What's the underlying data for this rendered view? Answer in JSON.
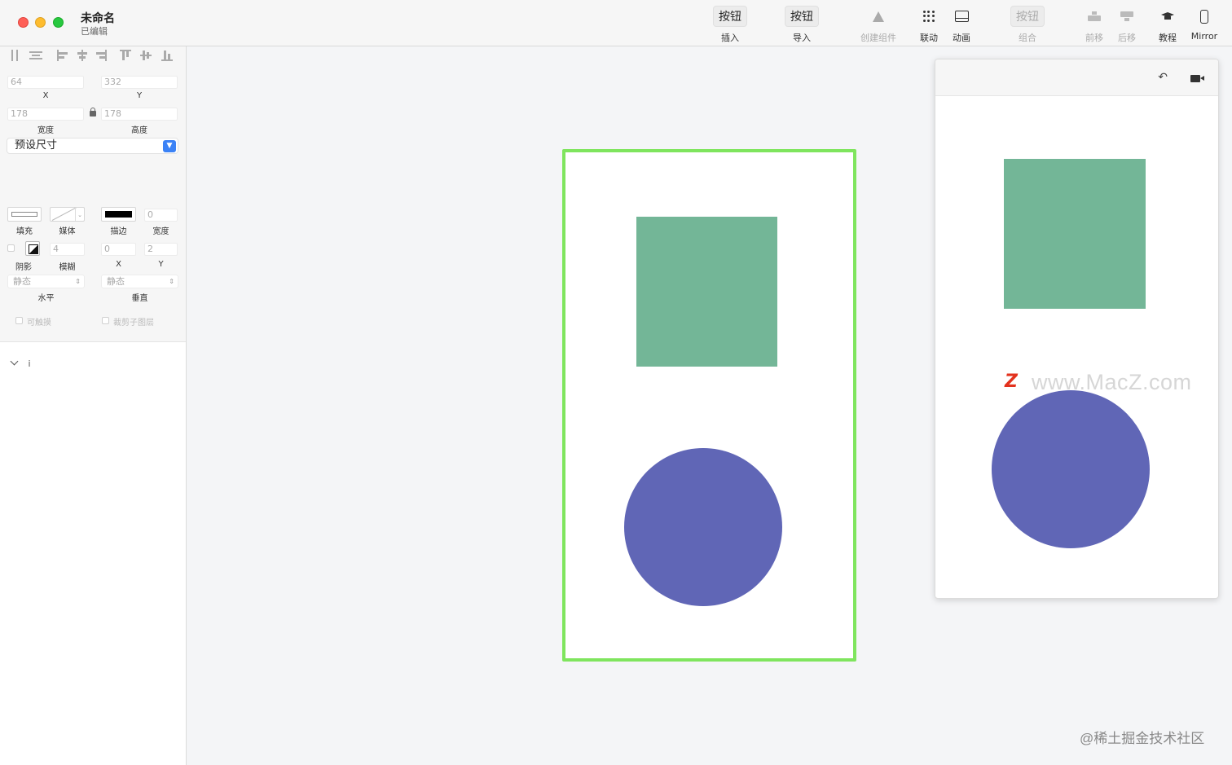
{
  "window": {
    "title": "未命名",
    "subtitle": "已编辑"
  },
  "toolbar": {
    "insert": {
      "button": "按钮",
      "label": "插入"
    },
    "import": {
      "button": "按钮",
      "label": "导入"
    },
    "create_component": {
      "label": "创建组件",
      "icon": "component-triangle-icon"
    },
    "link": {
      "label": "联动",
      "icon": "dots-grid-icon"
    },
    "animation": {
      "label": "动画",
      "icon": "animation-icon"
    },
    "group": {
      "button": "按钮",
      "label": "组合"
    },
    "bring_forward": {
      "label": "前移",
      "icon": "bring-forward-icon"
    },
    "send_backward": {
      "label": "后移",
      "icon": "send-backward-icon"
    },
    "tutorial": {
      "label": "教程",
      "icon": "graduation-cap-icon"
    },
    "mirror": {
      "label": "Mirror",
      "icon": "phone-icon"
    }
  },
  "inspector": {
    "x": {
      "value": "64",
      "label": "X"
    },
    "y": {
      "value": "332",
      "label": "Y"
    },
    "width": {
      "value": "178",
      "label": "宽度"
    },
    "height": {
      "value": "178",
      "label": "高度"
    },
    "preset_size": "预设尺寸",
    "fill_label": "填充",
    "media_label": "媒体",
    "stroke_label": "描边",
    "stroke_width": {
      "value": "0",
      "label": "宽度"
    },
    "shadow_label": "阴影",
    "blur": {
      "value": "4",
      "label": "模糊"
    },
    "shadow_x": {
      "value": "0",
      "label": "X"
    },
    "shadow_y": {
      "value": "2",
      "label": "Y"
    },
    "horizontal": {
      "value": "静态",
      "label": "水平"
    },
    "vertical": {
      "value": "静态",
      "label": "垂直"
    },
    "touchable_label": "可触摸",
    "clip_label": "裁剪子图层"
  },
  "layers": {
    "item": "i"
  },
  "colors": {
    "artboard_border": "#7fe55e",
    "square": "#73b697",
    "circle": "#6066b6",
    "accent": "#3b82f6"
  },
  "watermark": {
    "logo": "Z",
    "site": "www.MacZ.com",
    "corner": "@稀土掘金技术社区"
  }
}
